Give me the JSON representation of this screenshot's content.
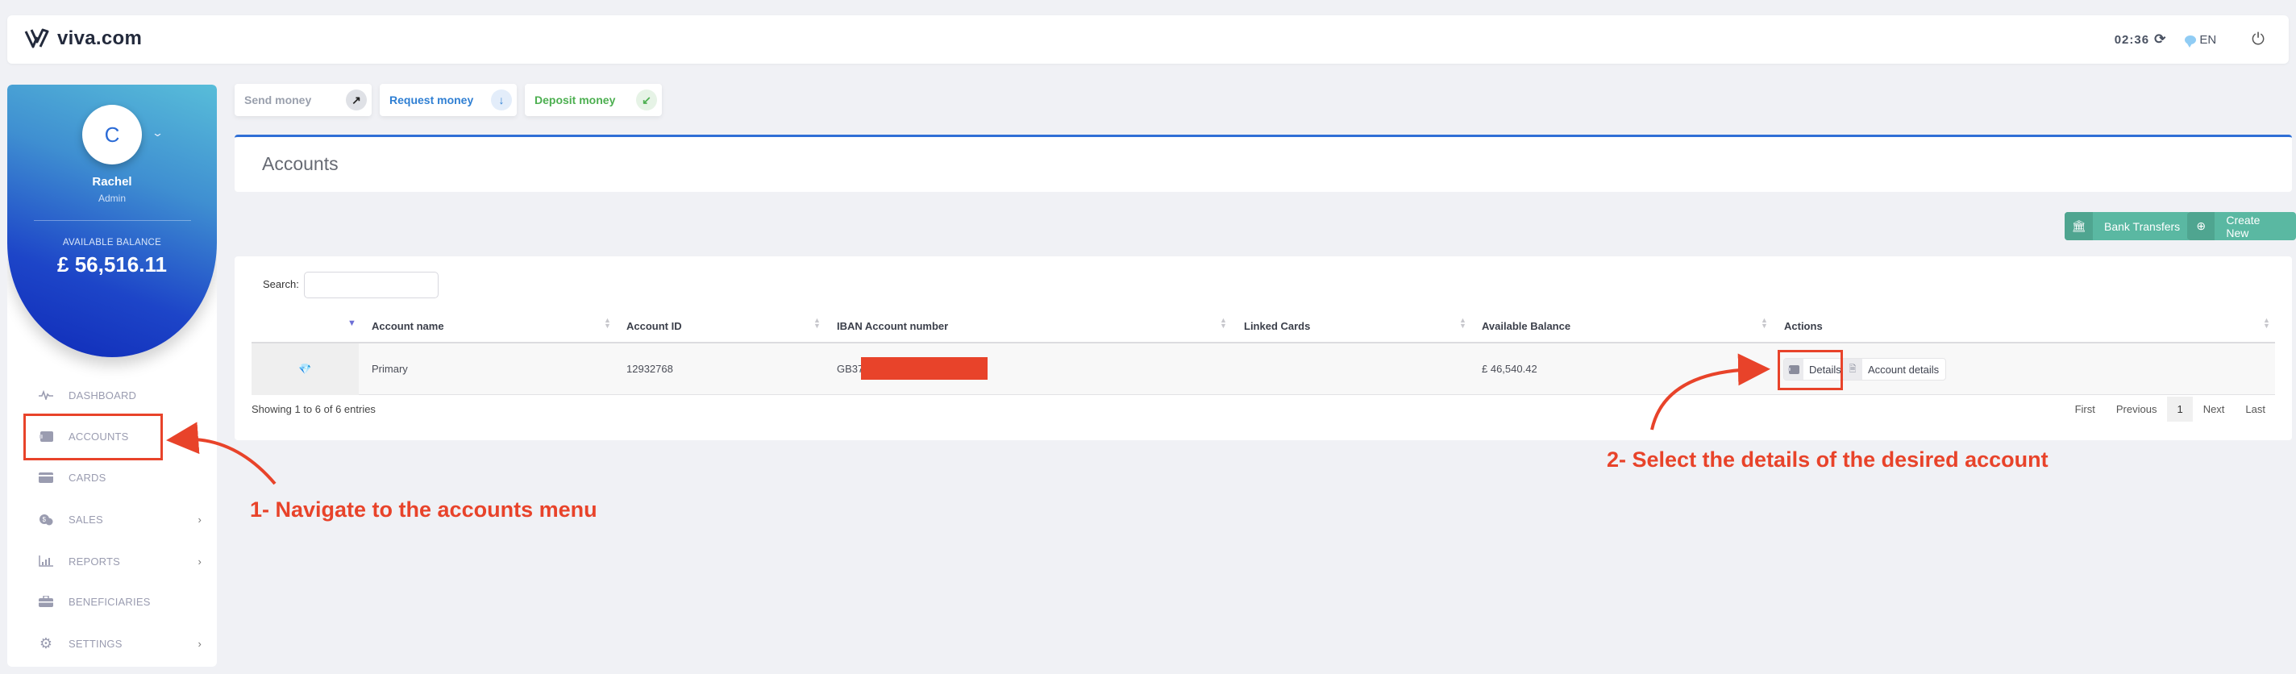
{
  "app": {
    "brand": "viva.com",
    "clock": "02:36",
    "language": "EN",
    "icons": {
      "refresh": "refresh-icon",
      "language": "chat-bubble-icon",
      "power": "power-icon"
    }
  },
  "profile": {
    "initial": "C",
    "name": "Rachel",
    "role": "Admin",
    "balance_label": "AVAILABLE BALANCE",
    "balance_value": "£ 56,516.11"
  },
  "sidebar": {
    "items": [
      {
        "label": "DASHBOARD",
        "icon": "pulse-icon",
        "has_submenu": false
      },
      {
        "label": "ACCOUNTS",
        "icon": "wallet-icon",
        "has_submenu": false,
        "highlighted": true
      },
      {
        "label": "CARDS",
        "icon": "card-icon",
        "has_submenu": false
      },
      {
        "label": "SALES",
        "icon": "sales-icon",
        "has_submenu": true
      },
      {
        "label": "REPORTS",
        "icon": "bar-chart-icon",
        "has_submenu": true
      },
      {
        "label": "BENEFICIARIES",
        "icon": "briefcase-icon",
        "has_submenu": false
      },
      {
        "label": "SETTINGS",
        "icon": "gear-icon",
        "has_submenu": true
      }
    ]
  },
  "quick_actions": [
    {
      "label": "Send money",
      "icon": "arrow-up-right-icon",
      "color": "#9aa0ad"
    },
    {
      "label": "Request money",
      "icon": "arrow-down-icon",
      "color": "#2f7fd3"
    },
    {
      "label": "Deposit money",
      "icon": "arrow-down-left-icon",
      "color": "#4caf50"
    }
  ],
  "page": {
    "title": "Accounts",
    "buttons": {
      "bank_transfers": "Bank Transfers",
      "create_new": "Create New"
    }
  },
  "table": {
    "search_label": "Search:",
    "search_value": "",
    "columns": [
      "Account name",
      "Account ID",
      "IBAN Account number",
      "Linked Cards",
      "Available Balance",
      "Actions"
    ],
    "rows": [
      {
        "account_name": "Primary",
        "account_id": "12932768",
        "iban": "GB37",
        "iban_redacted": true,
        "linked_cards": "",
        "available_balance": "£ 46,540.42",
        "actions": [
          "Details",
          "Account details"
        ]
      }
    ],
    "info": "Showing 1 to 6 of 6 entries",
    "pagination": {
      "first": "First",
      "previous": "Previous",
      "current": "1",
      "next": "Next",
      "last": "Last"
    }
  },
  "annotations": {
    "step1": "1- Navigate to the accounts menu",
    "step2": "2- Select the details of the desired account",
    "color": "#e8432a"
  }
}
